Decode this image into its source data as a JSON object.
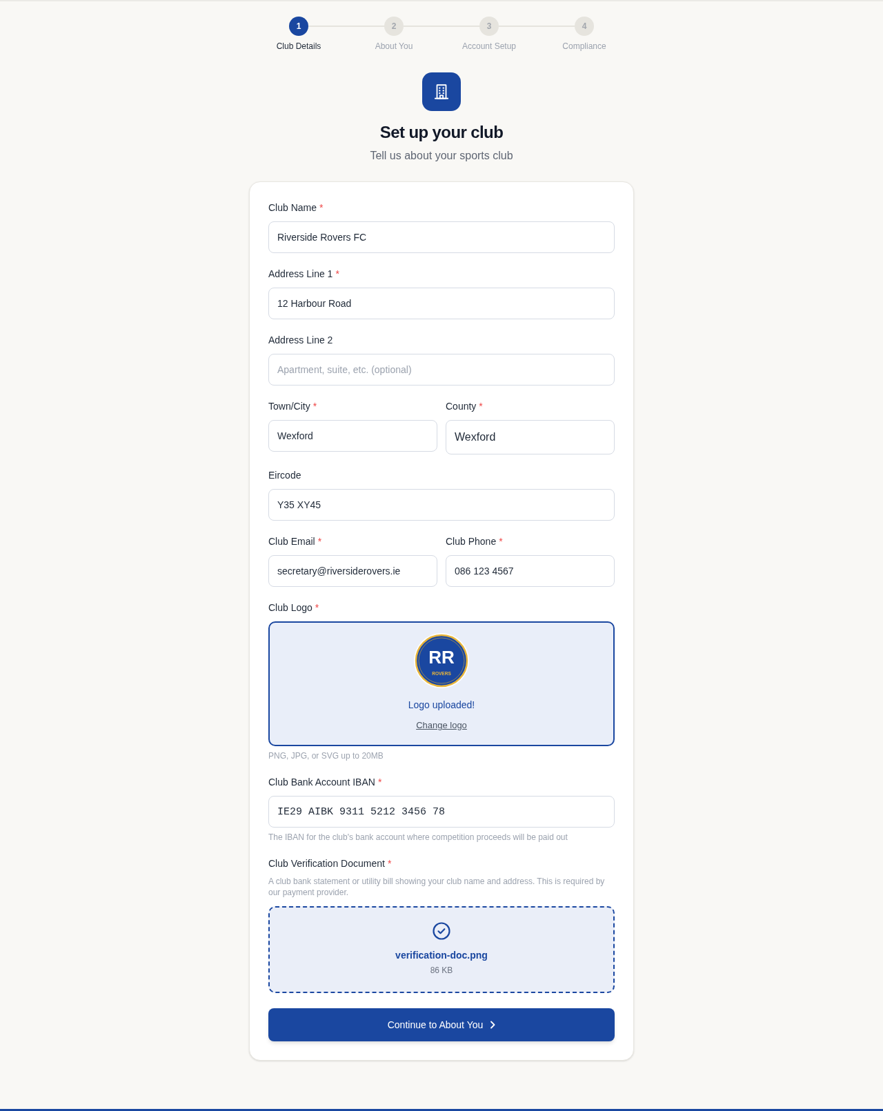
{
  "stepper": [
    {
      "number": "1",
      "label": "Club Details",
      "selected": true
    },
    {
      "number": "2",
      "label": "About You",
      "selected": false
    },
    {
      "number": "3",
      "label": "Account Setup",
      "selected": false
    },
    {
      "number": "4",
      "label": "Compliance",
      "selected": false
    }
  ],
  "header": {
    "title": "Set up your club",
    "subtitle": "Tell us about your sports club"
  },
  "form": {
    "rows": [
      [
        {
          "kind": "text",
          "label": "Club Name",
          "required_mark": "*",
          "value": "Riverside Rovers FC"
        }
      ],
      [
        {
          "kind": "text",
          "label": "Address Line 1",
          "required_mark": "*",
          "value": "12 Harbour Road"
        }
      ],
      [
        {
          "kind": "text",
          "label": "Address Line 2",
          "placeholder": "Apartment, suite, etc. (optional)"
        }
      ],
      [
        {
          "kind": "text",
          "label": "Town/City",
          "required_mark": "*",
          "value": "Wexford"
        },
        {
          "kind": "large_text",
          "label": "County",
          "required_mark": "*",
          "value": "Wexford"
        }
      ],
      [
        {
          "kind": "text",
          "label": "Eircode",
          "value": "Y35 XY45"
        }
      ],
      [
        {
          "kind": "text",
          "label": "Club Email",
          "required_mark": "*",
          "value": "secretary@riversiderovers.ie"
        },
        {
          "kind": "text",
          "label": "Club Phone",
          "required_mark": "*",
          "value": "086 123 4567"
        }
      ],
      [
        {
          "kind": "logo_upload",
          "label": "Club Logo",
          "required_mark": "*",
          "logo": {
            "initials": "RR",
            "caption": "ROVERS"
          },
          "status": "Logo uploaded!",
          "action": "Change logo",
          "hint": "PNG, JPG, or SVG up to 20MB"
        }
      ],
      [
        {
          "kind": "mono_text",
          "label": "Club Bank Account IBAN",
          "required_mark": "*",
          "value": "IE29 AIBK 9311 5212 3456 78",
          "hint": "The IBAN for the club's bank account where competition proceeds will be paid out"
        }
      ],
      [
        {
          "kind": "file_upload",
          "label": "Club Verification Document",
          "required_mark": "*",
          "description": "A club bank statement or utility bill showing your club name and address. This is required by our payment provider.",
          "file_name": "verification-doc.png",
          "file_size": "86 KB"
        }
      ]
    ]
  },
  "submit_button": {
    "label": "Continue to About You"
  }
}
